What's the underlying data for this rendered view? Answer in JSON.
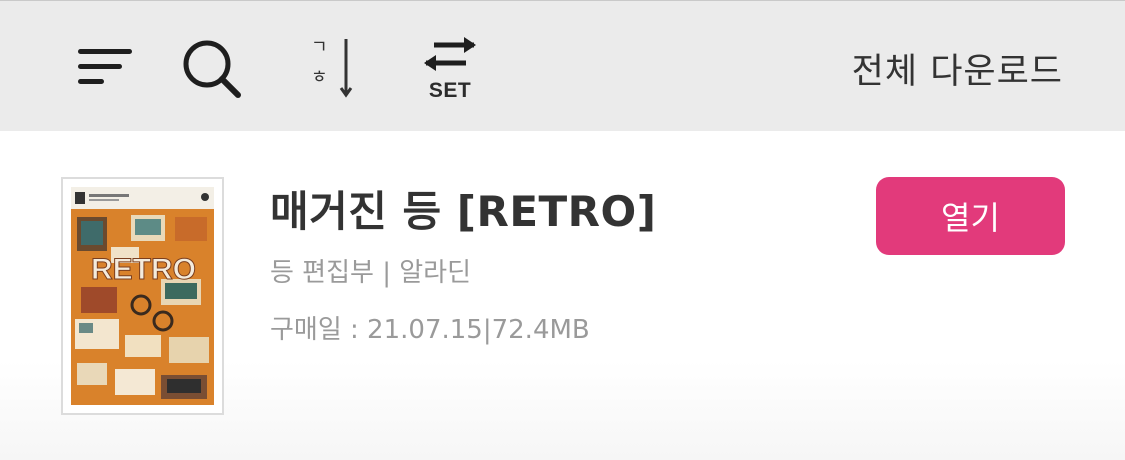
{
  "toolbar": {
    "menu_icon": "menu-lines-icon",
    "search_icon": "search-icon",
    "sort_icon": "sort-korean-order-icon",
    "sort_char_top": "ㄱ",
    "sort_char_bottom": "ㅎ",
    "set_icon": "swap-arrows-icon",
    "set_label": "SET",
    "download_all_label": "전체 다운로드"
  },
  "item": {
    "cover_icon": "book-cover-image",
    "cover_text": "RETRO",
    "title": "매거진 등 [RETRO]",
    "author_publisher": "등 편집부 | 알라딘",
    "purchase_info": "구매일 : 21.07.15|72.4MB",
    "open_label": "열기"
  },
  "colors": {
    "toolbar_bg": "#ebebeb",
    "accent": "#e23a7b",
    "cover_bg": "#d9822b"
  }
}
